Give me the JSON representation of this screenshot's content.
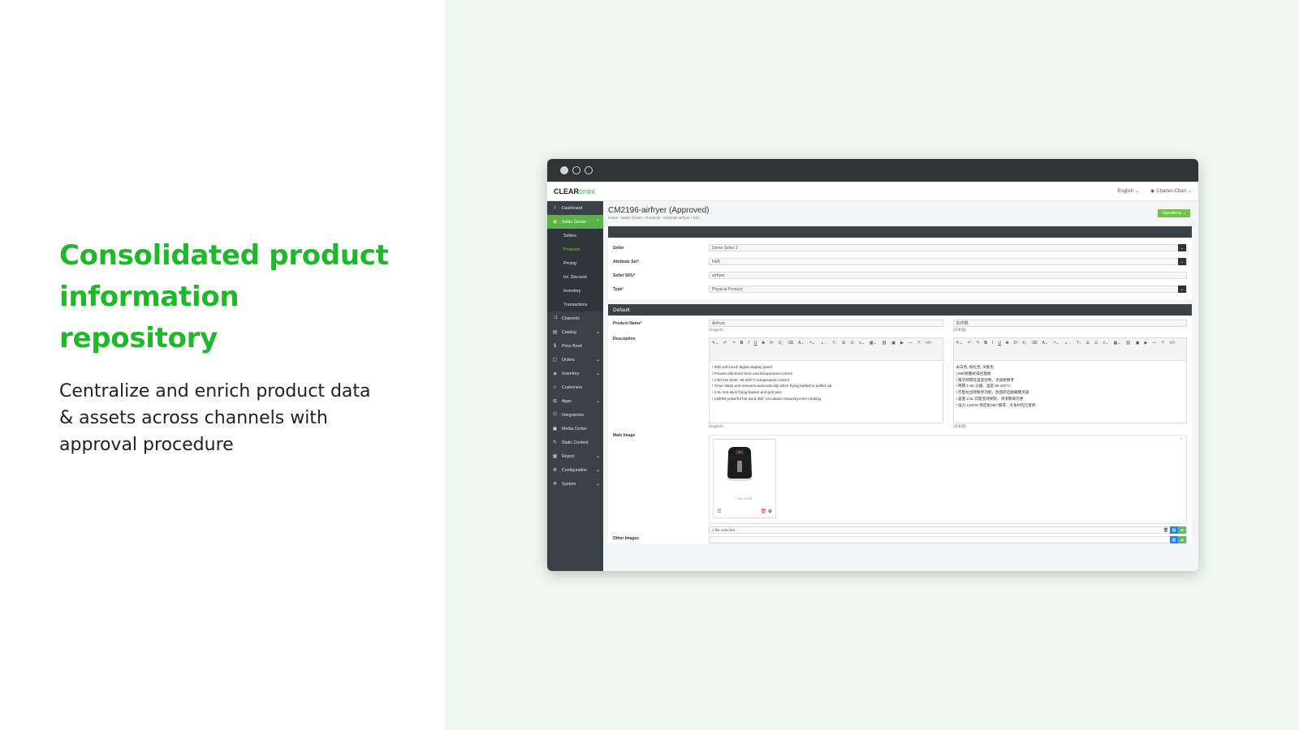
{
  "hero": {
    "heading": "Consolidated product information repository",
    "subtext": "Centralize and enrich product data & assets across channels with approval procedure"
  },
  "app": {
    "logo_main": "CLEAR",
    "logo_accent": "omni",
    "language": "English",
    "user": "Charles Chan"
  },
  "sidebar": {
    "items": [
      {
        "label": "Dashboard",
        "icon": "chart-icon"
      },
      {
        "label": "Seller Center",
        "icon": "store-icon",
        "active": true
      },
      {
        "label": "Sellers",
        "sub": true
      },
      {
        "label": "Products",
        "sub": true,
        "current": true
      },
      {
        "label": "Pricing",
        "sub": true
      },
      {
        "label": "Int. Discount",
        "sub": true
      },
      {
        "label": "Inventory",
        "sub": true
      },
      {
        "label": "Transactions",
        "sub": true
      },
      {
        "label": "Channels",
        "icon": "shuffle-icon"
      },
      {
        "label": "Catalog",
        "icon": "book-icon",
        "chevron": true
      },
      {
        "label": "Price Book",
        "icon": "dollar-icon"
      },
      {
        "label": "Orders",
        "icon": "clipboard-icon",
        "chevron": true
      },
      {
        "label": "Inventory",
        "icon": "box-icon",
        "chevron": true
      },
      {
        "label": "Customers",
        "icon": "users-icon"
      },
      {
        "label": "Apps",
        "icon": "grid-icon",
        "chevron": true
      },
      {
        "label": "Integrations",
        "icon": "plug-icon"
      },
      {
        "label": "Media Center",
        "icon": "image-icon"
      },
      {
        "label": "Static Content",
        "icon": "edit-icon"
      },
      {
        "label": "Report",
        "icon": "report-icon",
        "chevron": true
      },
      {
        "label": "Configuration",
        "icon": "gear-icon",
        "chevron": true
      },
      {
        "label": "System",
        "icon": "cog-icon",
        "chevron": true
      }
    ]
  },
  "page": {
    "title": "CM2196-airfryer (Approved)",
    "breadcrumb": [
      "Home",
      "Seller Center",
      "Products",
      "CM2196-airfryer"
    ],
    "breadcrumb_current": "Edit",
    "operations": "Operations"
  },
  "form": {
    "seller": {
      "label": "Seller",
      "value": "Demo Seller 2"
    },
    "attribute_set": {
      "label": "Attribute Set",
      "value": "F&B"
    },
    "seller_sku": {
      "label": "Seller SKU",
      "value": "airfryer"
    },
    "type": {
      "label": "Type",
      "value": "Physical Product"
    },
    "default_section": "Default",
    "product_name": {
      "label": "Product Name",
      "value_en": "Airfryer",
      "lang_en": "(English)",
      "value_jp": "氣炸鍋",
      "lang_jp": "(日本語)"
    },
    "description": {
      "label": "Description",
      "lang_en": "(English)",
      "lang_jp": "(日本語)",
      "lines_en": [
        "\\ IMD soft-touch digital display panel",
        "\\ Precise electronic time and temperature control",
        "\\ 1-60 min timer, 80-200°C temperature control",
        "\\ Timer stops and resumes automatically when frying basket is pulled out",
        "\\ 2.6L non-stick frying basket and grill rack",
        "\\ 1400W powerful hot wind 360° circulation ensuring even cooking"
      ],
      "lines_jp": [
        "米白色, 粉紅色, 深藍色",
        "\\ IMD輕觸式操控面板",
        "\\ 電子時間及溫度控制，烹調更精準",
        "\\ 時間 1-60 分鐘，溫度 80-200°C",
        "\\ 炸籃拉出時暫停功能，放回即自動繼續烹調",
        "\\ 容量 2.6L 炸籃及烤網架，清潔簡單方便",
        "\\ 強力 1400W 熱空氣360°循環，令食材均勻受熱"
      ]
    },
    "main_image": {
      "label": "Main Image",
      "size": "128.22 KB",
      "file_status": "1 file selected"
    },
    "other_images": {
      "label": "Other Images"
    }
  },
  "colors": {
    "brand_green": "#1fb82a",
    "sidebar_bg": "#3a4147",
    "active_green": "#5bb348"
  }
}
